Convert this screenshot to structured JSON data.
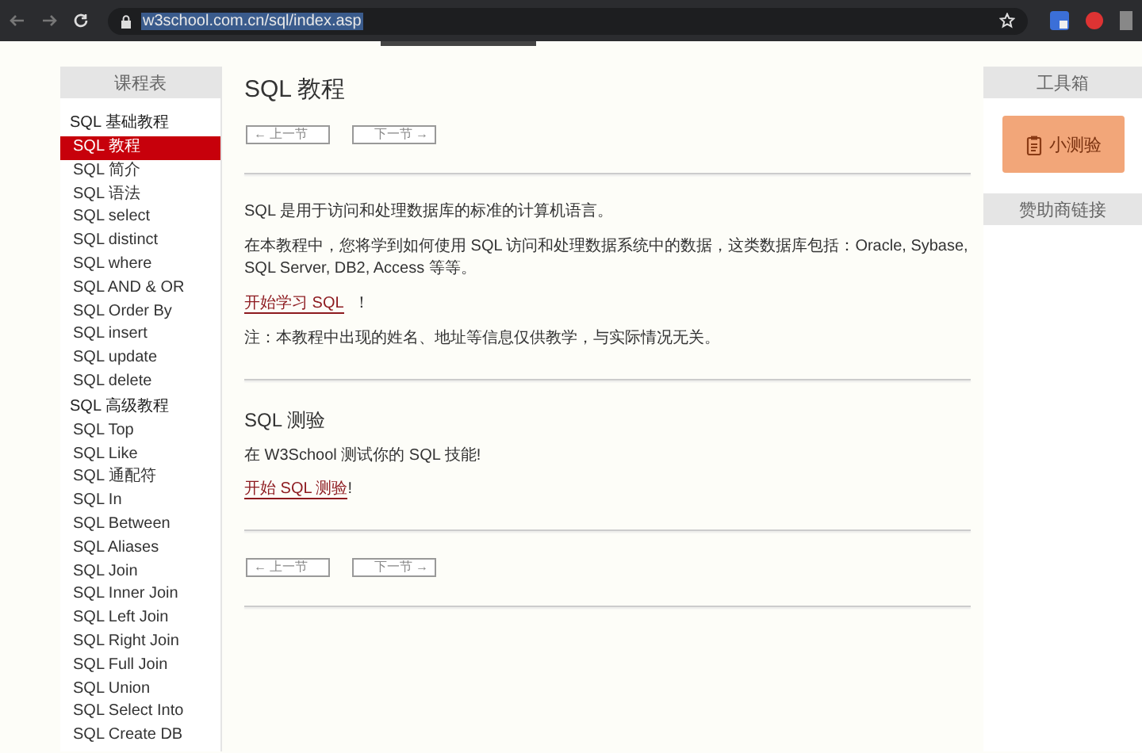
{
  "browser": {
    "url": "w3school.com.cn/sql/index.asp"
  },
  "sidebar": {
    "title": "课程表",
    "sections": [
      {
        "heading": "SQL 基础教程",
        "items": [
          {
            "label": "SQL 教程",
            "selected": true
          },
          {
            "label": "SQL 简介",
            "selected": false
          },
          {
            "label": "SQL 语法",
            "selected": false
          },
          {
            "label": "SQL select",
            "selected": false
          },
          {
            "label": "SQL distinct",
            "selected": false
          },
          {
            "label": "SQL where",
            "selected": false
          },
          {
            "label": "SQL AND & OR",
            "selected": false
          },
          {
            "label": "SQL Order By",
            "selected": false
          },
          {
            "label": "SQL insert",
            "selected": false
          },
          {
            "label": "SQL update",
            "selected": false
          },
          {
            "label": "SQL delete",
            "selected": false
          }
        ]
      },
      {
        "heading": "SQL 高级教程",
        "items": [
          {
            "label": "SQL Top",
            "selected": false
          },
          {
            "label": "SQL Like",
            "selected": false
          },
          {
            "label": "SQL 通配符",
            "selected": false
          },
          {
            "label": "SQL In",
            "selected": false
          },
          {
            "label": "SQL Between",
            "selected": false
          },
          {
            "label": "SQL Aliases",
            "selected": false
          },
          {
            "label": "SQL Join",
            "selected": false
          },
          {
            "label": "SQL Inner Join",
            "selected": false
          },
          {
            "label": "SQL Left Join",
            "selected": false
          },
          {
            "label": "SQL Right Join",
            "selected": false
          },
          {
            "label": "SQL Full Join",
            "selected": false
          },
          {
            "label": "SQL Union",
            "selected": false
          },
          {
            "label": "SQL Select Into",
            "selected": false
          },
          {
            "label": "SQL Create DB",
            "selected": false
          }
        ]
      }
    ]
  },
  "content": {
    "title": "SQL 教程",
    "nav_top": [
      "← 上一节",
      "下一节 →"
    ],
    "intro": [
      {
        "kind": "text",
        "text": "SQL 是用于访问和处理数据库的标准的计算机语言。"
      },
      {
        "kind": "text",
        "text": "在本教程中，您将学到如何使用 SQL 访问和处理数据系统中的数据，这类数据库包括：Oracle, Sybase, SQL Server, DB2, Access 等等。"
      },
      {
        "kind": "link",
        "link": "开始学习 SQL",
        "suffix": "！"
      },
      {
        "kind": "text",
        "text": "注：本教程中出现的姓名、地址等信息仅供教学，与实际情况无关。"
      }
    ],
    "quiz": {
      "title": "SQL 测验",
      "text": "在 W3School 测试你的 SQL 技能!",
      "link": "开始 SQL 测验",
      "suffix": "!"
    },
    "nav_bottom": [
      "← 上一节",
      "下一节 →"
    ]
  },
  "toolbox": {
    "title": "工具箱",
    "button": "小测验",
    "sponsors": "赞助商链接"
  }
}
